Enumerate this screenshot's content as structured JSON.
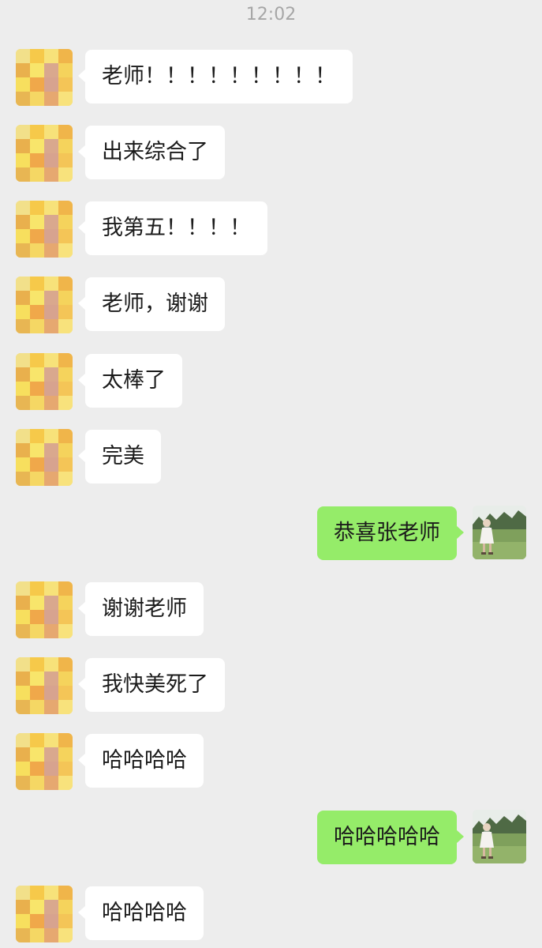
{
  "status": {
    "time": "12:02"
  },
  "colors": {
    "background": "#ededed",
    "incoming_bubble": "#ffffff",
    "outgoing_bubble": "#95ec69"
  },
  "messages": [
    {
      "side": "left",
      "text": "老师！！！！！！！！！",
      "avatar": "pixelated-contact-avatar-icon"
    },
    {
      "side": "left",
      "text": "出来综合了",
      "avatar": "pixelated-contact-avatar-icon"
    },
    {
      "side": "left",
      "text": "我第五！！！！",
      "avatar": "pixelated-contact-avatar-icon"
    },
    {
      "side": "left",
      "text": "老师，谢谢",
      "avatar": "pixelated-contact-avatar-icon"
    },
    {
      "side": "left",
      "text": "太棒了",
      "avatar": "pixelated-contact-avatar-icon"
    },
    {
      "side": "left",
      "text": "完美",
      "avatar": "pixelated-contact-avatar-icon"
    },
    {
      "side": "right",
      "text": "恭喜张老师",
      "avatar": "user-photo-avatar-icon"
    },
    {
      "side": "left",
      "text": "谢谢老师",
      "avatar": "pixelated-contact-avatar-icon"
    },
    {
      "side": "left",
      "text": "我快美死了",
      "avatar": "pixelated-contact-avatar-icon"
    },
    {
      "side": "left",
      "text": "哈哈哈哈",
      "avatar": "pixelated-contact-avatar-icon"
    },
    {
      "side": "right",
      "text": "哈哈哈哈哈",
      "avatar": "user-photo-avatar-icon"
    },
    {
      "side": "left",
      "text": "哈哈哈哈",
      "avatar": "pixelated-contact-avatar-icon"
    }
  ]
}
